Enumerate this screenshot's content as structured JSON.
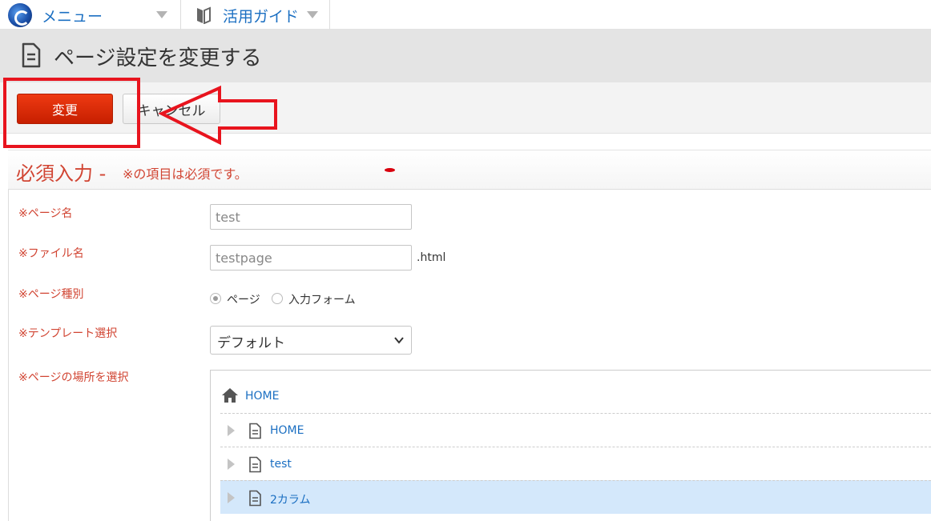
{
  "topbar": {
    "menu_label": "メニュー",
    "guide_label": "活用ガイド"
  },
  "page": {
    "title": "ページ設定を変更する"
  },
  "actions": {
    "change_label": "変更",
    "cancel_label": "キャンセル"
  },
  "section": {
    "title": "必須入力 -",
    "note": "※の項目は必須です。"
  },
  "form": {
    "page_name": {
      "label": "※ページ名",
      "value": "test"
    },
    "file_name": {
      "label": "※ファイル名",
      "value": "testpage",
      "suffix": ".html"
    },
    "page_type": {
      "label": "※ページ種別",
      "options": [
        "ページ",
        "入力フォーム"
      ],
      "selected": "ページ"
    },
    "template": {
      "label": "※テンプレート選択",
      "value": "デフォルト"
    },
    "location": {
      "label": "※ページの場所を選択"
    }
  },
  "tree": {
    "root_label": "HOME",
    "items": [
      {
        "label": "HOME",
        "selected": false
      },
      {
        "label": "test",
        "selected": false
      },
      {
        "label": "2カラム",
        "selected": true
      }
    ]
  },
  "colors": {
    "accent_link": "#1b6fc2",
    "required_red": "#d14533",
    "primary_button": "#dd2b08",
    "annotation_red": "#e8141e",
    "selected_row": "#d4e8fb"
  }
}
